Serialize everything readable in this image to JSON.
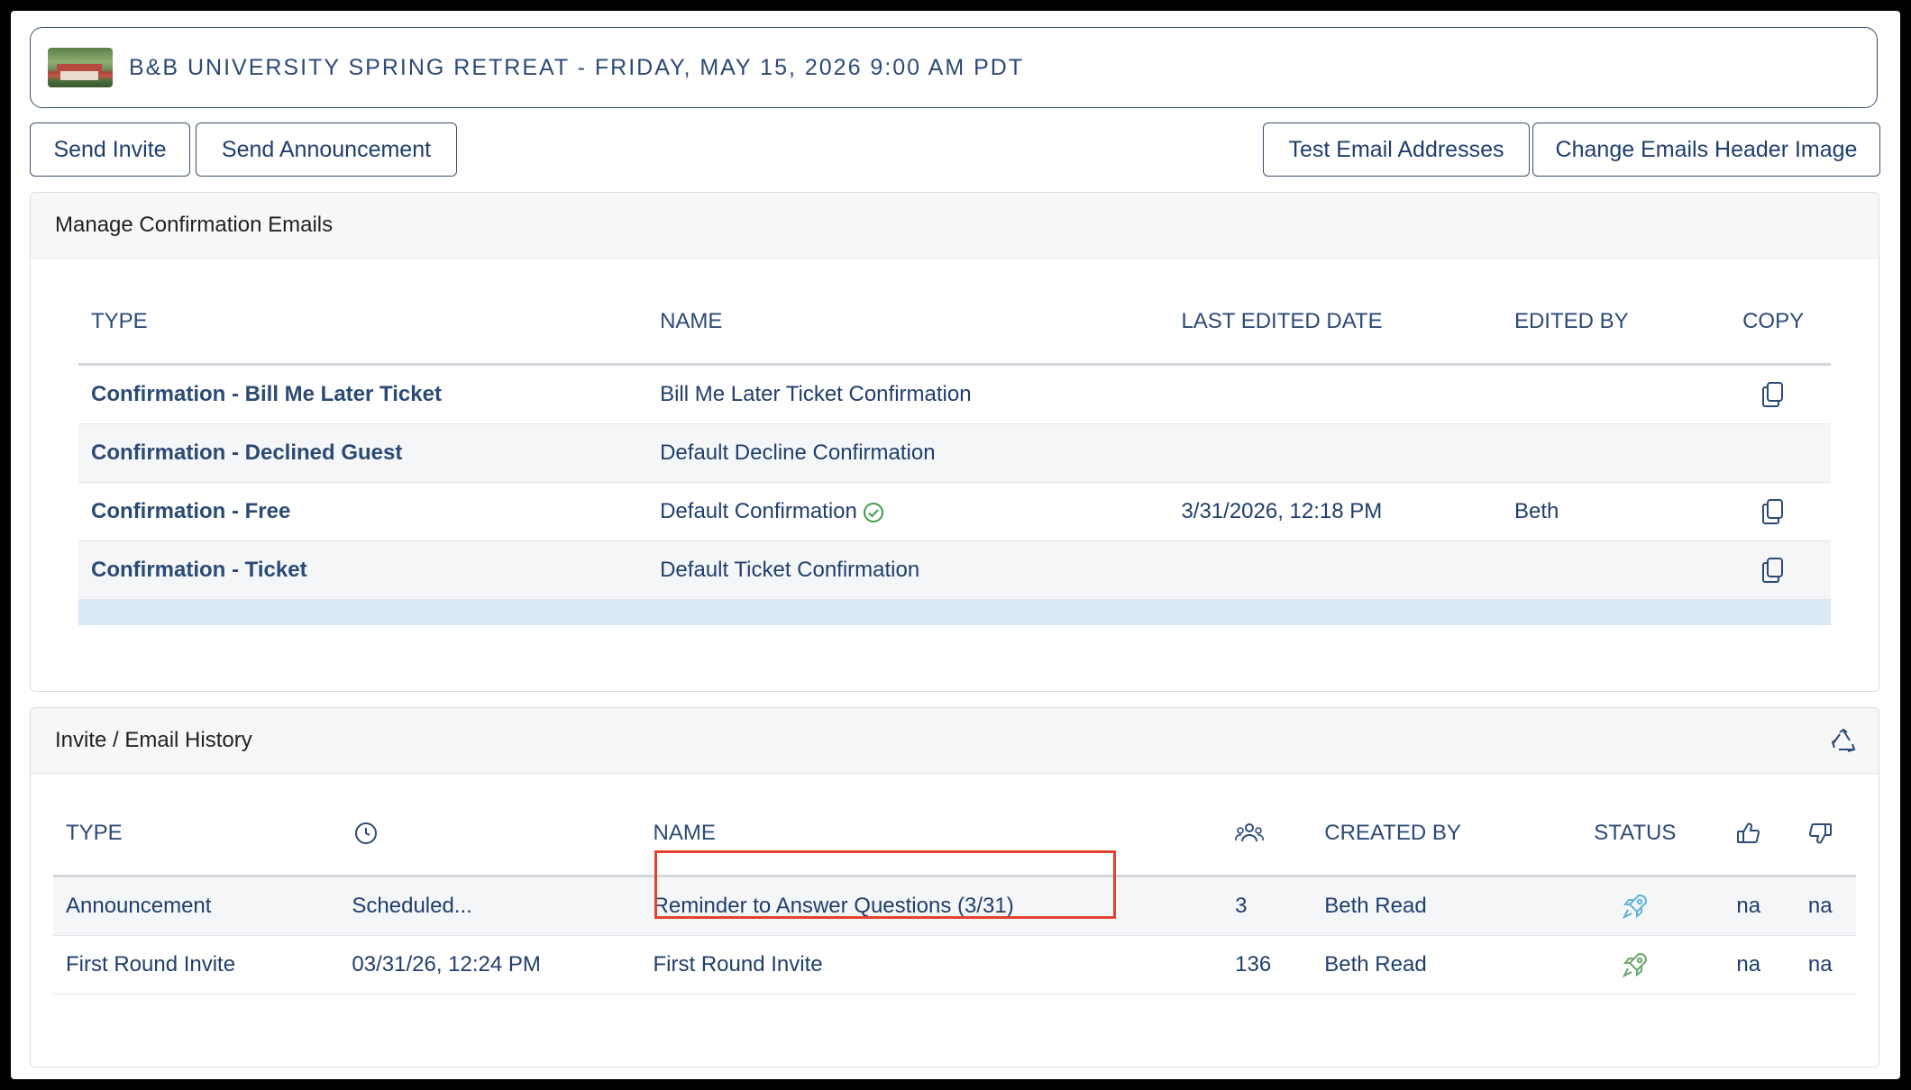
{
  "event": {
    "title": "B&B UNIVERSITY SPRING RETREAT - FRIDAY, MAY 15, 2026 9:00 AM PDT"
  },
  "toolbar": {
    "send_invite": "Send Invite",
    "send_announcement": "Send Announcement",
    "test_email_addresses": "Test Email Addresses",
    "change_header_image": "Change Emails Header Image"
  },
  "confirmation": {
    "title": "Manage Confirmation Emails",
    "headers": {
      "type": "TYPE",
      "name": "NAME",
      "last_edited": "LAST EDITED DATE",
      "edited_by": "EDITED BY",
      "copy": "COPY"
    },
    "rows": [
      {
        "type": "Confirmation - Bill Me Later Ticket",
        "name": "Bill Me Later Ticket Confirmation",
        "last_edited": "",
        "edited_by": "",
        "copy": true
      },
      {
        "type": "Confirmation - Declined Guest",
        "name": "Default Decline Confirmation",
        "last_edited": "",
        "edited_by": "",
        "copy": false
      },
      {
        "type": "Confirmation - Free",
        "name": "Default Confirmation",
        "last_edited": "3/31/2026, 12:18 PM",
        "edited_by": "Beth",
        "copy": true,
        "verified": true
      },
      {
        "type": "Confirmation - Ticket",
        "name": "Default Ticket Confirmation",
        "last_edited": "",
        "edited_by": "",
        "copy": true
      }
    ]
  },
  "history": {
    "title": "Invite / Email History",
    "headers": {
      "type": "TYPE",
      "time_icon": "clock-icon",
      "name": "NAME",
      "recipients_icon": "people-icon",
      "created_by": "CREATED BY",
      "status": "STATUS",
      "likes_icon": "thumbs-up-icon",
      "dislikes_icon": "thumbs-down-icon"
    },
    "rows": [
      {
        "type": "Announcement",
        "time": "Scheduled...",
        "name": "Reminder to Answer Questions (3/31)",
        "recipients": "3",
        "created_by": "Beth Read",
        "status_icon": "rocket-icon",
        "status_color": "#5fb3d6",
        "likes": "na",
        "dislikes": "na"
      },
      {
        "type": "First Round Invite",
        "time": "03/31/26, 12:24 PM",
        "name": "First Round Invite",
        "recipients": "136",
        "created_by": "Beth Read",
        "status_icon": "rocket-icon",
        "status_color": "#6aa56a",
        "likes": "na",
        "dislikes": "na"
      }
    ]
  },
  "colors": {
    "accent": "#2c4a76",
    "highlight": "#e2432f",
    "selected_row": "#dbe9f4"
  }
}
